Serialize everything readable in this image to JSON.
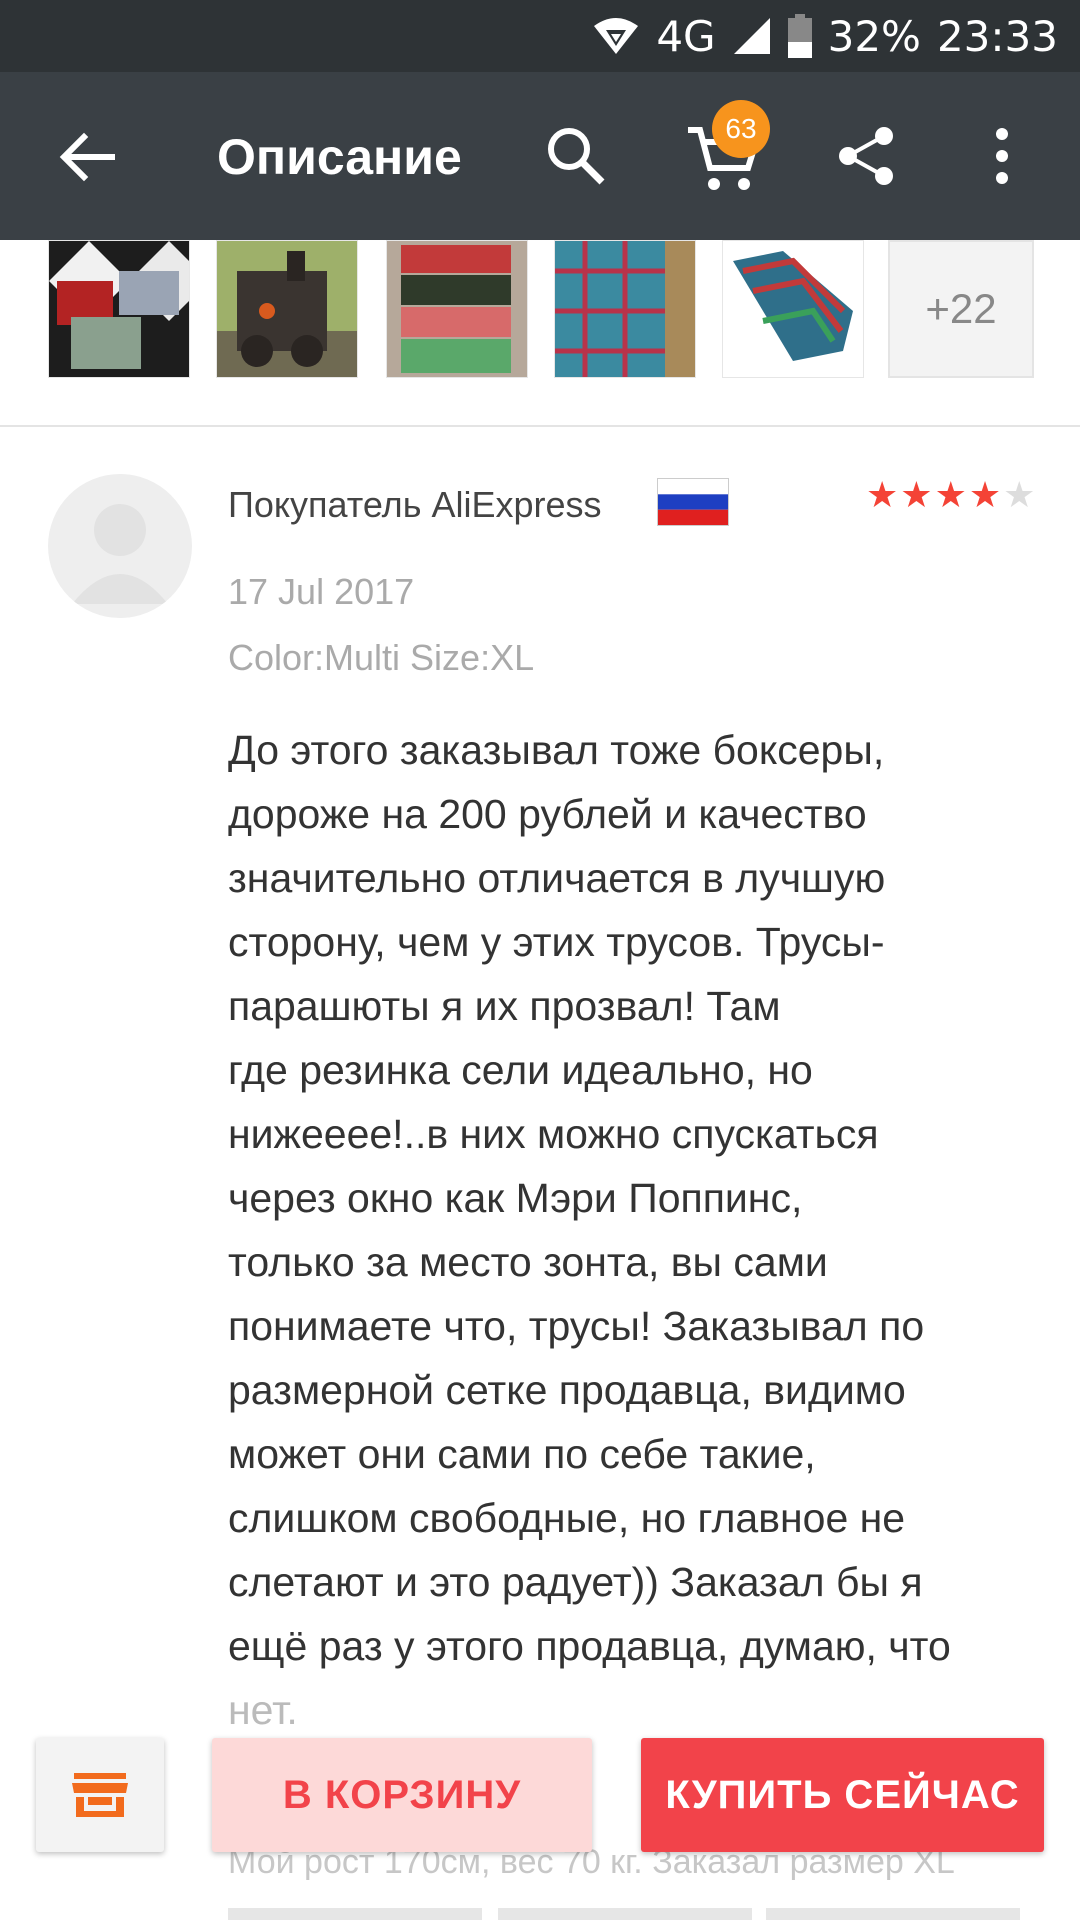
{
  "status_bar": {
    "network": "4G",
    "battery": "32%",
    "time": "23:33"
  },
  "app_bar": {
    "title": "Описание",
    "cart_count": "63"
  },
  "thumbnails": {
    "more_label": "+22"
  },
  "review": {
    "reviewer": "Покупатель AliExpress",
    "rating": 4,
    "rating_max": 5,
    "date": "17 Jul 2017",
    "sku": "Color:Multi Size:XL",
    "text_main": "До этого заказывал тоже боксеры,\nдороже на 200 рублей и качество\nзначительно отличается в лучшую\nсторону, чем у этих трусов. Трусы-\nпарашюты я их прозвал! Там\nгде резинка сели идеально, но\nнижееее!..в них можно спускаться\nчерез окно как Мэри Поппинс,\nтолько за место зонта, вы сами\nпонимаете что, трусы! Заказывал по\nразмерной сетке продавца, видимо\nможет они сами по себе такие,\nслишком свободные, но главное не\nслетают и это радует)) Заказал бы я\nещё раз у этого продавца, думаю, что",
    "text_tail": "нет.",
    "additional": "Мой рост 170см, вес 70 кг. Заказал размер XL"
  },
  "bottom_bar": {
    "cart_button": "В КОРЗИНУ",
    "buy_button": "КУПИТЬ СЕЙЧАС"
  },
  "colors": {
    "accent": "#f2434a",
    "badge": "#f7941d",
    "appbar": "#3a4045"
  }
}
